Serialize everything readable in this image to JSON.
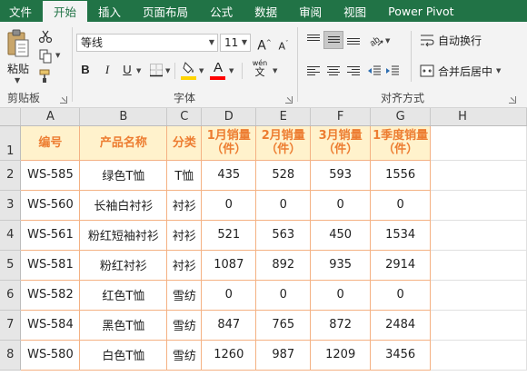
{
  "ribbon_tabs": [
    "文件",
    "开始",
    "插入",
    "页面布局",
    "公式",
    "数据",
    "审阅",
    "视图",
    "Power Pivot"
  ],
  "active_tab": "开始",
  "clipboard": {
    "paste_label": "粘贴",
    "group_label": "剪贴板"
  },
  "font": {
    "name": "等线",
    "size": "11",
    "group_label": "字体",
    "bold": "B",
    "italic": "I",
    "underline": "U",
    "grow": "A",
    "shrink": "A",
    "font_color": "A",
    "phonetic": "wén"
  },
  "alignment": {
    "wrap_label": "自动换行",
    "merge_label": "合并后居中",
    "group_label": "对齐方式"
  },
  "colors": {
    "brand": "#217346",
    "header_fill": "#fff2cc",
    "header_text": "#ed7d31",
    "border": "#f4b183"
  },
  "sheet": {
    "columns": [
      "A",
      "B",
      "C",
      "D",
      "E",
      "F",
      "G",
      "H"
    ],
    "header_row": [
      "编号",
      "产品名称",
      "分类",
      "1月销量（件）",
      "2月销量（件）",
      "3月销量（件）",
      "1季度销量（件）"
    ],
    "rows": [
      {
        "row": "2",
        "cells": [
          "WS-585",
          "绿色T恤",
          "T恤",
          "435",
          "528",
          "593",
          "1556"
        ]
      },
      {
        "row": "3",
        "cells": [
          "WS-560",
          "长袖白衬衫",
          "衬衫",
          "0",
          "0",
          "0",
          "0"
        ]
      },
      {
        "row": "4",
        "cells": [
          "WS-561",
          "粉红短袖衬衫",
          "衬衫",
          "521",
          "563",
          "450",
          "1534"
        ]
      },
      {
        "row": "5",
        "cells": [
          "WS-581",
          "粉红衬衫",
          "衬衫",
          "1087",
          "892",
          "935",
          "2914"
        ]
      },
      {
        "row": "6",
        "cells": [
          "WS-582",
          "红色T恤",
          "雪纺",
          "0",
          "0",
          "0",
          "0"
        ]
      },
      {
        "row": "7",
        "cells": [
          "WS-584",
          "黑色T恤",
          "雪纺",
          "847",
          "765",
          "872",
          "2484"
        ]
      },
      {
        "row": "8",
        "cells": [
          "WS-580",
          "白色T恤",
          "雪纺",
          "1260",
          "987",
          "1209",
          "3456"
        ]
      }
    ]
  }
}
